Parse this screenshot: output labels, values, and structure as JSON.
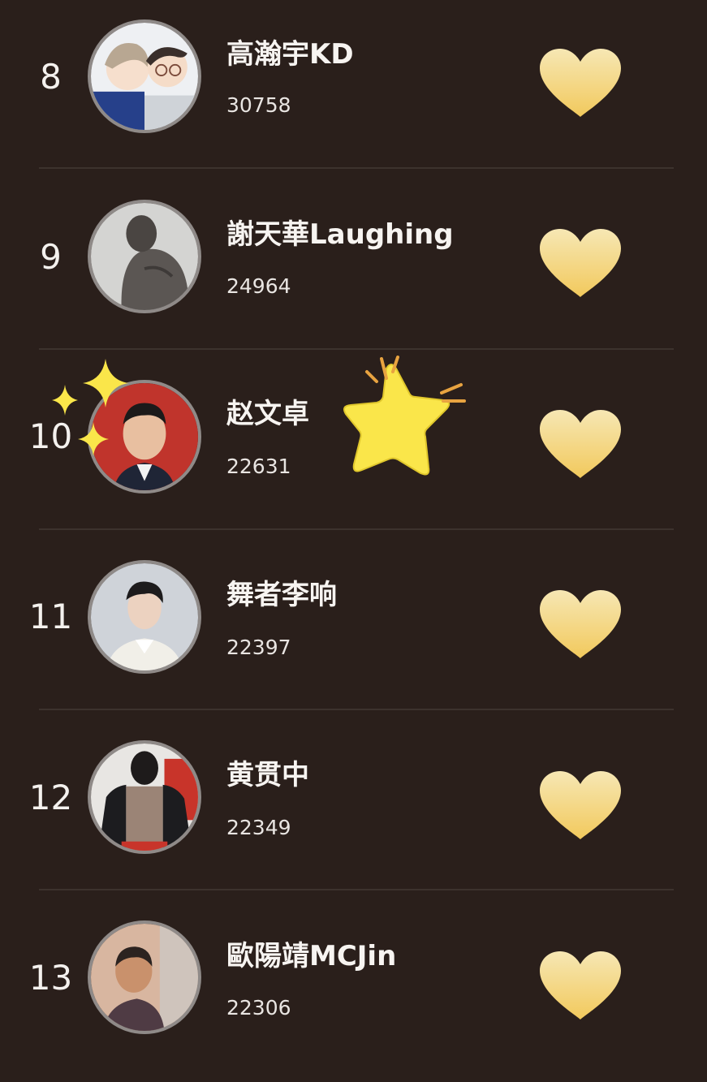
{
  "entries": [
    {
      "rank": "8",
      "name": "高瀚宇KD",
      "score": "30758",
      "avatar": "cartoon-couple"
    },
    {
      "rank": "9",
      "name": "謝天華Laughing",
      "score": "24964",
      "avatar": "muscular-back"
    },
    {
      "rank": "10",
      "name": "赵文卓",
      "score": "22631",
      "avatar": "man-red-bg"
    },
    {
      "rank": "11",
      "name": "舞者李响",
      "score": "22397",
      "avatar": "young-man-white"
    },
    {
      "rank": "12",
      "name": "黄贯中",
      "score": "22349",
      "avatar": "shirtless-jacket"
    },
    {
      "rank": "13",
      "name": "歐陽靖MCJin",
      "score": "22306",
      "avatar": "child-photo"
    }
  ],
  "icons": {
    "vote": "heart-icon",
    "highlight_star": "star-icon",
    "sparkles": "sparkle-icon"
  },
  "colors": {
    "background": "#2a1f1b",
    "heart_top": "#f6e7b4",
    "heart_bottom": "#f2c95c",
    "star": "#fae64a",
    "rank_text": "#f4f1ee"
  }
}
